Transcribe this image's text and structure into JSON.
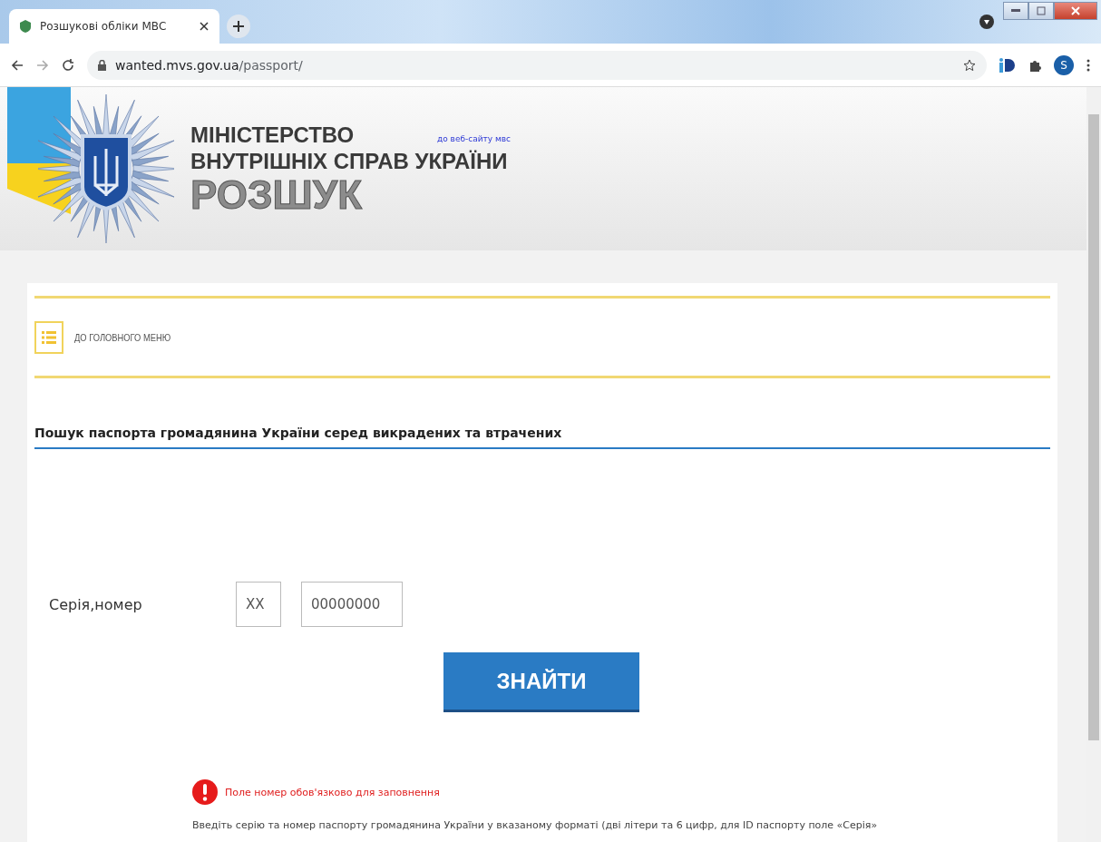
{
  "browser": {
    "tab": {
      "title": "Розшукові обліки МВС",
      "selected": true
    },
    "address": {
      "host": "wanted.mvs.gov.ua",
      "path": "/passport/"
    },
    "profile_initial": "S"
  },
  "header": {
    "title_line1": "МІНІСТЕРСТВО",
    "title_line2": "ВНУТРІШНІХ СПРАВ УКРАЇНИ",
    "subtitle": "РОЗШУК",
    "site_link": "до веб-сайту мвс"
  },
  "menu_link": "ДО ГОЛОВНОГО МЕНЮ",
  "search": {
    "heading": "Пошук паспорта громадянина України серед викрадених та втрачених",
    "label": "Серія,номер",
    "series": {
      "placeholder": "XX"
    },
    "number": {
      "placeholder": "00000000"
    },
    "button": "ЗНАЙТИ"
  },
  "error": "Поле номер обов'язково для заповнення",
  "hint": "Введіть серію та номер паспорту громадянина України у вказаному форматі (дві літери та 6 цифр, для ID паспорту поле «Серія»"
}
